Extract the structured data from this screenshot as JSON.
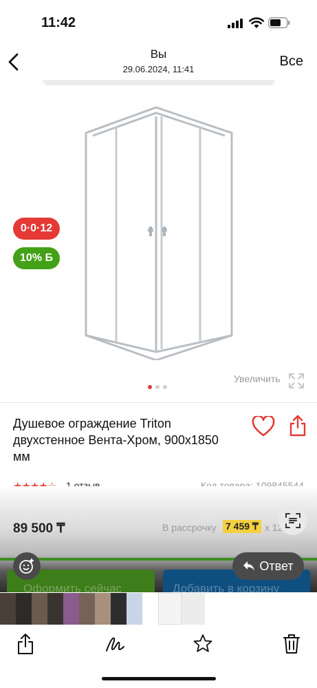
{
  "status_bar": {
    "time": "11:42"
  },
  "header": {
    "sender": "Вы",
    "datetime": "29.06.2024, 11:41",
    "all_label": "Все"
  },
  "product": {
    "badge_installment": "0·0·12",
    "badge_bonus": "10% Б",
    "zoom_label": "Увеличить",
    "gallery_total": 3,
    "gallery_active": 1,
    "title": "Душевое ограждение Triton двухстенное Вента-Хром, 900x1850 мм",
    "rating_stars": 4,
    "reviews": "1 отзыв",
    "code": "Код товара: 109845544",
    "price": "89 500 ₸",
    "installment_label": "В рассрочку",
    "installment_amount": "7 459 ₸",
    "installment_months": "x 12",
    "buy_now": "Оформить сейчас",
    "add_to_cart": "Добавить в корзину",
    "reply_label": "Ответ"
  },
  "colors": {
    "accent_red": "#e53935",
    "bonus_green": "#43a117",
    "installment_yellow": "#f4d03f"
  },
  "toolbar": [
    "share-icon",
    "markup-icon",
    "favorite-icon",
    "trash-icon"
  ]
}
